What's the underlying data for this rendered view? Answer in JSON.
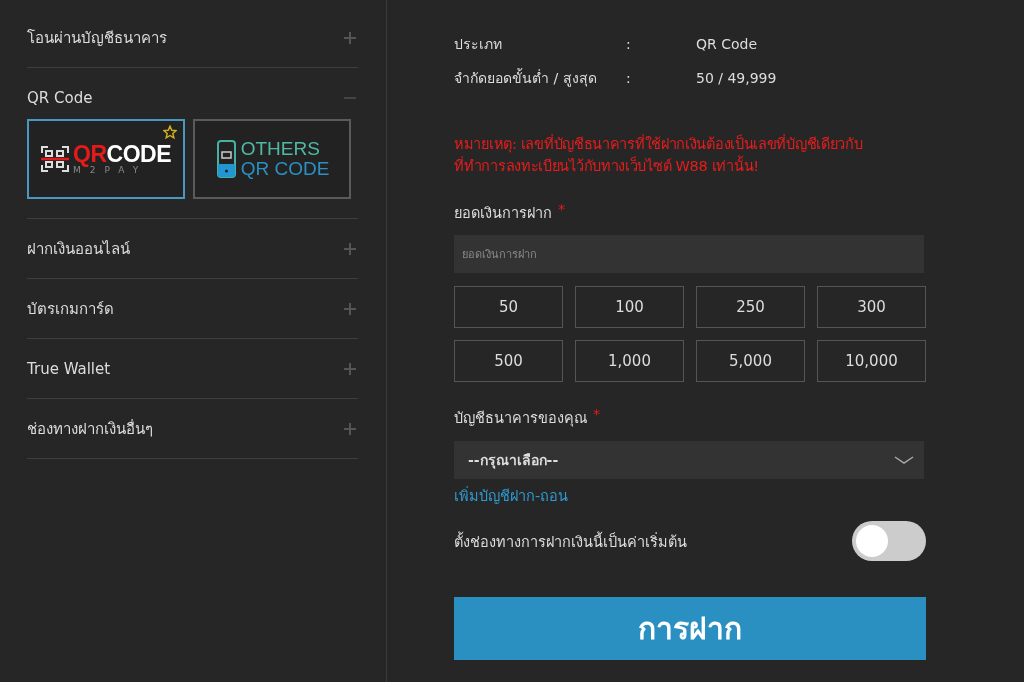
{
  "sidebar": {
    "items": [
      {
        "label": "โอนผ่านบัญชีธนาคาร",
        "expanded": false
      },
      {
        "label": "QR Code",
        "expanded": true,
        "tiles": [
          {
            "kind": "m2pay",
            "selected": true,
            "favorite": true,
            "parts": [
              "QR",
              "CODE"
            ],
            "sub": "M2PAY"
          },
          {
            "kind": "others",
            "selected": false,
            "favorite": false,
            "parts": [
              "OTHERS",
              "QR CODE"
            ]
          }
        ]
      },
      {
        "label": "ฝากเงินออนไลน์",
        "expanded": false
      },
      {
        "label": "บัตรเกมการ์ด",
        "expanded": false
      },
      {
        "label": "True Wallet",
        "expanded": false
      },
      {
        "label": "ช่องทางฝากเงินอื่นๆ",
        "expanded": false
      }
    ]
  },
  "info": [
    {
      "label": "ประเภท",
      "sep": ":",
      "value": "QR Code"
    },
    {
      "label": "จำกัดยอดขั้นต่ำ / สูงสุด",
      "sep": ":",
      "value": "50 / 49,999"
    }
  ],
  "note": "หมายเหตุ: เลขที่บัญชีธนาคารที่ใช้ฝากเงินต้องเป็นเลขที่บัญชีเดียวกับที่ทำการลงทะเบียนไว้กับทางเว็บไซต์ W88 เท่านั้น!",
  "amount": {
    "label": "ยอดเงินการฝาก",
    "required": "*",
    "placeholder": "ยอดเงินการฝาก",
    "presets": [
      "50",
      "100",
      "250",
      "300",
      "500",
      "1,000",
      "5,000",
      "10,000"
    ]
  },
  "bank": {
    "label": "บัญชีธนาคารของคุณ",
    "required": "*",
    "value": "--กรุณาเลือก--",
    "link": "เพิ่มบัญชีฝาก-ถอน"
  },
  "default_toggle": {
    "label": "ตั้งช่องทางการฝากเงินนี้เป็นค่าเริ่มต้น",
    "on": false
  },
  "submit": "การฝาก"
}
